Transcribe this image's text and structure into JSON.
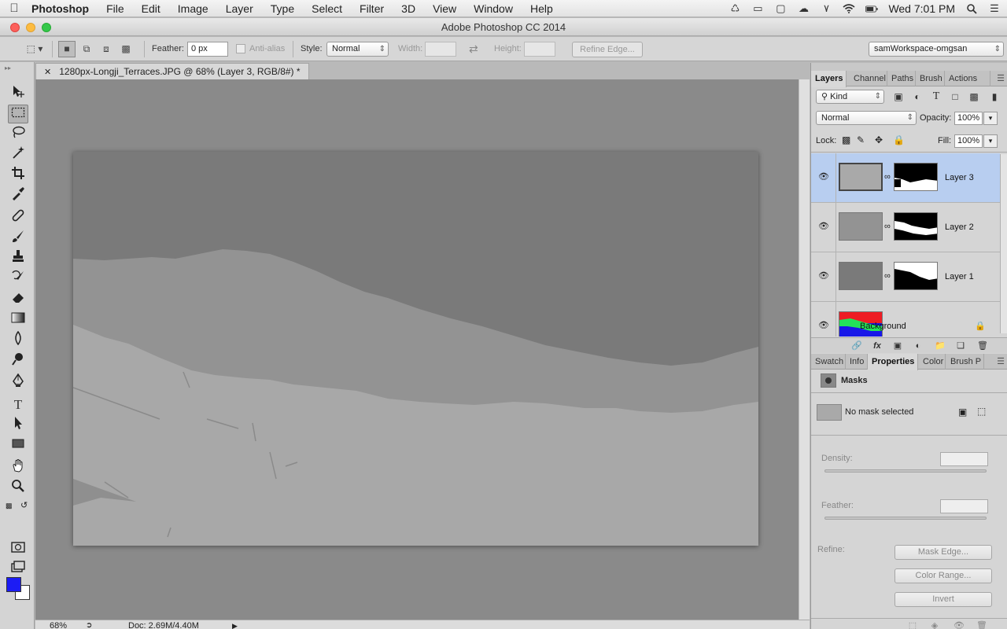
{
  "menubar": {
    "items": [
      "Photoshop",
      "File",
      "Edit",
      "Image",
      "Layer",
      "Type",
      "Select",
      "Filter",
      "3D",
      "View",
      "Window",
      "Help"
    ],
    "clock": "Wed 7:01 PM"
  },
  "window": {
    "title": "Adobe Photoshop CC 2014"
  },
  "options": {
    "feather_label": "Feather:",
    "feather_value": "0 px",
    "antialias_label": "Anti-alias",
    "style_label": "Style:",
    "style_value": "Normal",
    "width_label": "Width:",
    "height_label": "Height:",
    "refine_edge": "Refine Edge...",
    "workspace": "samWorkspace-omgsan"
  },
  "document": {
    "tab_title": "1280px-Longji_Terraces.JPG @ 68% (Layer 3, RGB/8#) *",
    "zoom": "68%",
    "doc_info": "Doc: 2.69M/4.40M"
  },
  "layers_panel": {
    "tabs": [
      "Layers",
      "Channel",
      "Paths",
      "Brush",
      "Actions"
    ],
    "filter_kind": "Kind",
    "blend_mode": "Normal",
    "opacity_label": "Opacity:",
    "opacity": "100%",
    "lock_label": "Lock:",
    "fill_label": "Fill:",
    "fill": "100%",
    "layers": [
      {
        "name": "Layer 3",
        "selected": true
      },
      {
        "name": "Layer 2",
        "selected": false
      },
      {
        "name": "Layer 1",
        "selected": false
      },
      {
        "name": "Background",
        "selected": false
      }
    ]
  },
  "properties_panel": {
    "tabs": [
      "Swatch",
      "Info",
      "Properties",
      "Color",
      "Brush P"
    ],
    "title": "Masks",
    "no_mask": "No mask selected",
    "density_label": "Density:",
    "feather_label": "Feather:",
    "refine_label": "Refine:",
    "mask_edge": "Mask Edge...",
    "color_range": "Color Range...",
    "invert": "Invert"
  },
  "colors": {
    "foreground": "#1c1cf4",
    "background": "#ffffff",
    "selection": "#b8cef0"
  }
}
